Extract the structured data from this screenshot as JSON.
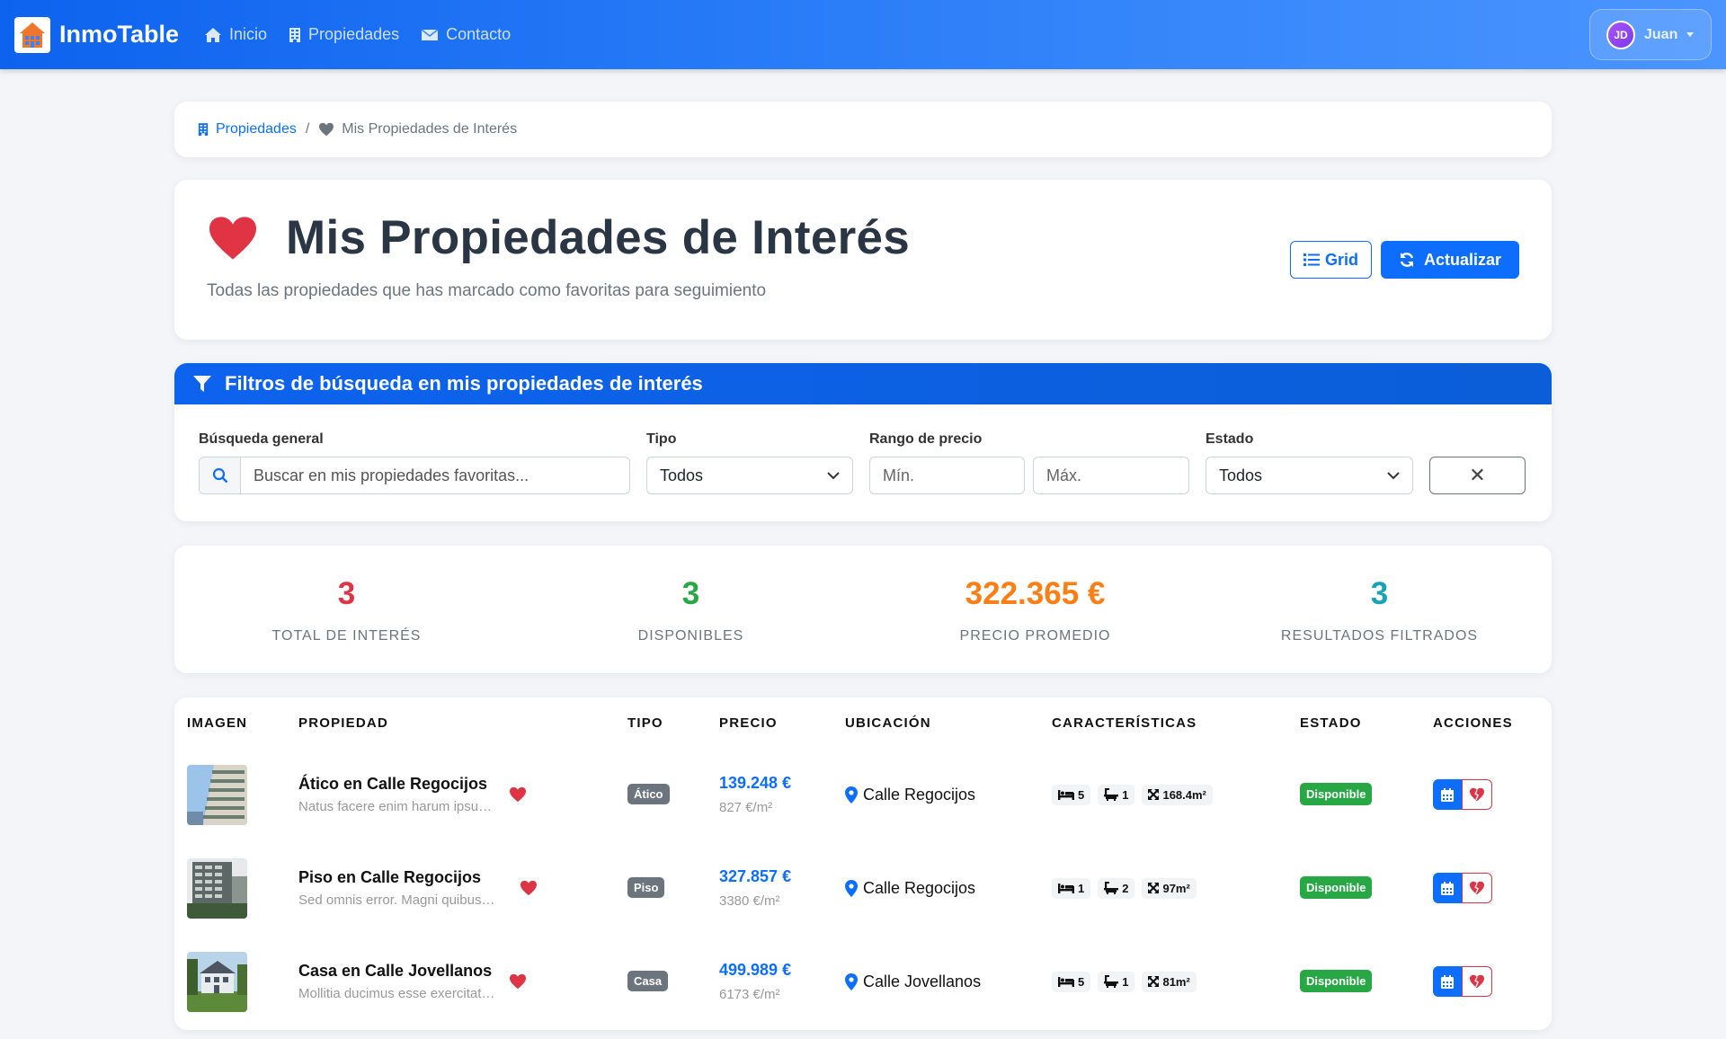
{
  "nav": {
    "brand": "InmoTable",
    "links": [
      "Inicio",
      "Propiedades",
      "Contacto"
    ],
    "user_initials": "JD",
    "user_name": "Juan"
  },
  "breadcrumb": {
    "parent": "Propiedades",
    "current": "Mis Propiedades de Interés"
  },
  "header": {
    "title": "Mis Propiedades de Interés",
    "subtitle": "Todas las propiedades que has marcado como favoritas para seguimiento",
    "grid_label": "Grid",
    "refresh_label": "Actualizar"
  },
  "filters": {
    "title": "Filtros de búsqueda en mis propiedades de interés",
    "search_label": "Búsqueda general",
    "search_placeholder": "Buscar en mis propiedades favoritas...",
    "type_label": "Tipo",
    "type_value": "Todos",
    "price_label": "Rango de precio",
    "min_placeholder": "Mín.",
    "max_placeholder": "Máx.",
    "status_label": "Estado",
    "status_value": "Todos",
    "clear_label": "✕"
  },
  "stats": [
    {
      "value": "3",
      "label": "TOTAL DE INTERÉS",
      "color": "#dc3545"
    },
    {
      "value": "3",
      "label": "DISPONIBLES",
      "color": "#28a745"
    },
    {
      "value": "322.365 €",
      "label": "PRECIO PROMEDIO",
      "color": "#fd7e14"
    },
    {
      "value": "3",
      "label": "RESULTADOS FILTRADOS",
      "color": "#17a2b8"
    }
  ],
  "table": {
    "headers": [
      "IMAGEN",
      "PROPIEDAD",
      "TIPO",
      "PRECIO",
      "UBICACIÓN",
      "CARACTERÍSTICAS",
      "ESTADO",
      "ACCIONES"
    ],
    "rows": [
      {
        "title": "Ático en Calle Regocijos",
        "desc": "Natus facere enim harum ipsum dolores",
        "type": "Ático",
        "price": "139.248 €",
        "price_m2": "827 €/m²",
        "location": "Calle Regocijos",
        "beds": "5",
        "baths": "1",
        "area": "168.4m²",
        "status": "Disponible"
      },
      {
        "title": "Piso en Calle Regocijos",
        "desc": "Sed omnis error. Magni quibusdam vel",
        "type": "Piso",
        "price": "327.857 €",
        "price_m2": "3380 €/m²",
        "location": "Calle Regocijos",
        "beds": "1",
        "baths": "2",
        "area": "97m²",
        "status": "Disponible"
      },
      {
        "title": "Casa en Calle Jovellanos",
        "desc": "Mollitia ducimus esse exercitationem quia",
        "type": "Casa",
        "price": "499.989 €",
        "price_m2": "6173 €/m²",
        "location": "Calle Jovellanos",
        "beds": "5",
        "baths": "1",
        "area": "81m²",
        "status": "Disponible"
      }
    ]
  },
  "colors": {
    "primary": "#0d6efd",
    "danger": "#dc3545",
    "success": "#28a745",
    "warning": "#fd7e14",
    "info": "#17a2b8"
  }
}
